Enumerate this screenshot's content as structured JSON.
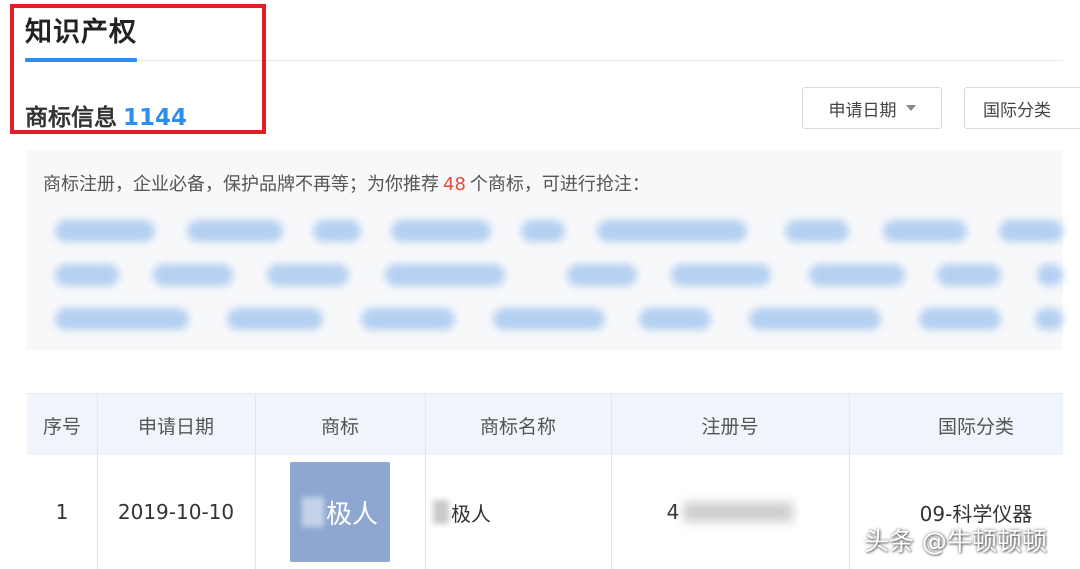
{
  "tab": {
    "title": "知识产权"
  },
  "section": {
    "title": "商标信息",
    "count": "1144"
  },
  "filters": {
    "date_label": "申请日期",
    "class_label": "国际分类"
  },
  "recommend": {
    "text_before": "商标注册，企业必备，保护品牌不再等；为你推荐",
    "count": "48",
    "text_after": "个商标，可进行抢注："
  },
  "table": {
    "headers": [
      "序号",
      "申请日期",
      "商标",
      "商标名称",
      "注册号",
      "国际分类"
    ],
    "rows": [
      {
        "index": "1",
        "date": "2019-10-10",
        "logo_text": "极人",
        "name": "极人",
        "reg_no_prefix": "4",
        "intl_class": "09-科学仪器"
      }
    ]
  },
  "watermark": "头条 @牛顿顿顿",
  "colors": {
    "accent": "#2e8ef0",
    "highlight_box": "#e41e26",
    "count_red": "#e8493c"
  }
}
